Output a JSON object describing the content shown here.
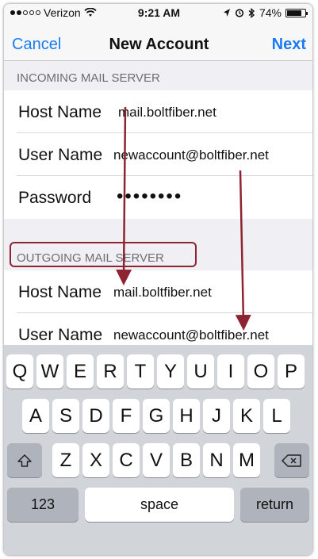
{
  "status_bar": {
    "carrier": "Verizon",
    "time": "9:21 AM",
    "battery": "74%",
    "battery_level": 0.74,
    "signal_bars": 2,
    "icons": [
      "signal-dots-icon",
      "wifi-icon",
      "location-arrow-icon",
      "alarm-icon",
      "bluetooth-icon",
      "battery-icon"
    ]
  },
  "nav": {
    "cancel": "Cancel",
    "title": "New Account",
    "next": "Next"
  },
  "incoming": {
    "header": "INCOMING MAIL SERVER",
    "host_label": "Host Name",
    "host_value": "mail.boltfiber.net",
    "user_label": "User Name",
    "user_value": "newaccount@boltfiber.net",
    "password_label": "Password",
    "password_value": "••••••••"
  },
  "outgoing": {
    "header": "OUTGOING MAIL SERVER",
    "host_label": "Host Name",
    "host_value": "mail.boltfiber.net",
    "user_label": "User Name",
    "user_value": "newaccount@boltfiber.net"
  },
  "keyboard": {
    "row1": [
      "Q",
      "W",
      "E",
      "R",
      "T",
      "Y",
      "U",
      "I",
      "O",
      "P"
    ],
    "row2": [
      "A",
      "S",
      "D",
      "F",
      "G",
      "H",
      "J",
      "K",
      "L"
    ],
    "row3": [
      "Z",
      "X",
      "C",
      "V",
      "B",
      "N",
      "M"
    ],
    "numbers": "123",
    "space": "space",
    "return": "return"
  },
  "colors": {
    "accent": "#1a7cf5",
    "annotation": "#8e2431"
  }
}
